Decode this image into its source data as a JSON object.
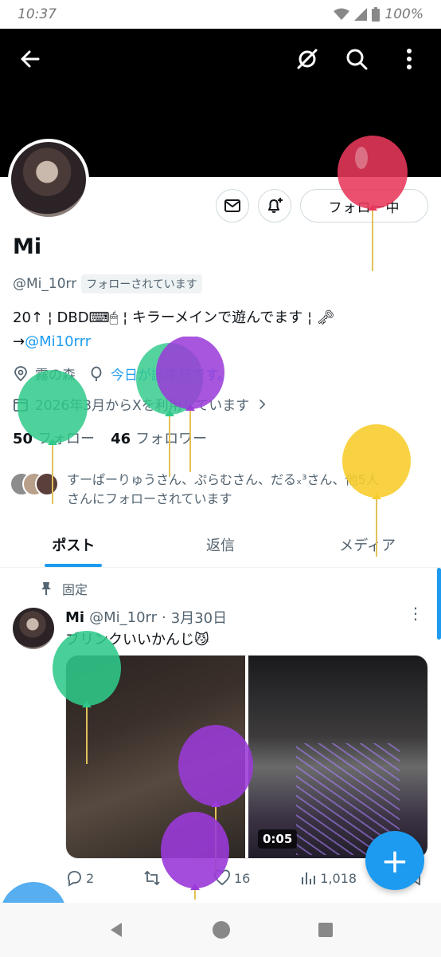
{
  "status_bar": {
    "time": "10:37",
    "battery": "100%"
  },
  "profile": {
    "name": "Mi",
    "handle": "@Mi_10rr",
    "follows_you": "フォローされています",
    "bio_line1": "20↑ ¦ DBD⌨🖱 ¦ キラーメインで遊んでます ¦ 🗝",
    "bio_arrow": "→",
    "bio_link": "@Mi10rrr",
    "location": "霧の森",
    "birthday": "今日が誕生日です。",
    "joined": "2026年3月からXを利用しています",
    "following_count": "50",
    "following_label": "フォロー",
    "followers_count": "46",
    "followers_label": "フォロワー",
    "followed_by_line1": "すーぱーりゅうさん、ぷらむさん、だるₓ³さん、他5人",
    "followed_by_line2": "さんにフォローされています",
    "follow_button": "フォロー中"
  },
  "tabs": [
    {
      "label": "ポスト",
      "active": true
    },
    {
      "label": "返信",
      "active": false
    },
    {
      "label": "メディア",
      "active": false
    }
  ],
  "post": {
    "pinned_label": "固定",
    "author": "Mi",
    "handle": "@Mi_10rr",
    "dot": "·",
    "date": "3月30日",
    "text": "ブリンクいいかんじ😼",
    "video_duration": "0:05",
    "replies": "2",
    "retweets": "",
    "likes": "16",
    "views": "1,018"
  },
  "colors": {
    "accent": "#1d9bf0",
    "banner": "#000000"
  },
  "icons": [
    "back-arrow-icon",
    "no-filter-icon",
    "search-icon",
    "more-icon",
    "mail-icon",
    "bell-plus-icon",
    "location-icon",
    "balloon-icon",
    "calendar-icon",
    "pin-icon",
    "reply-icon",
    "retweet-icon",
    "like-icon",
    "views-icon",
    "bookmark-icon",
    "compose-plus-icon"
  ]
}
